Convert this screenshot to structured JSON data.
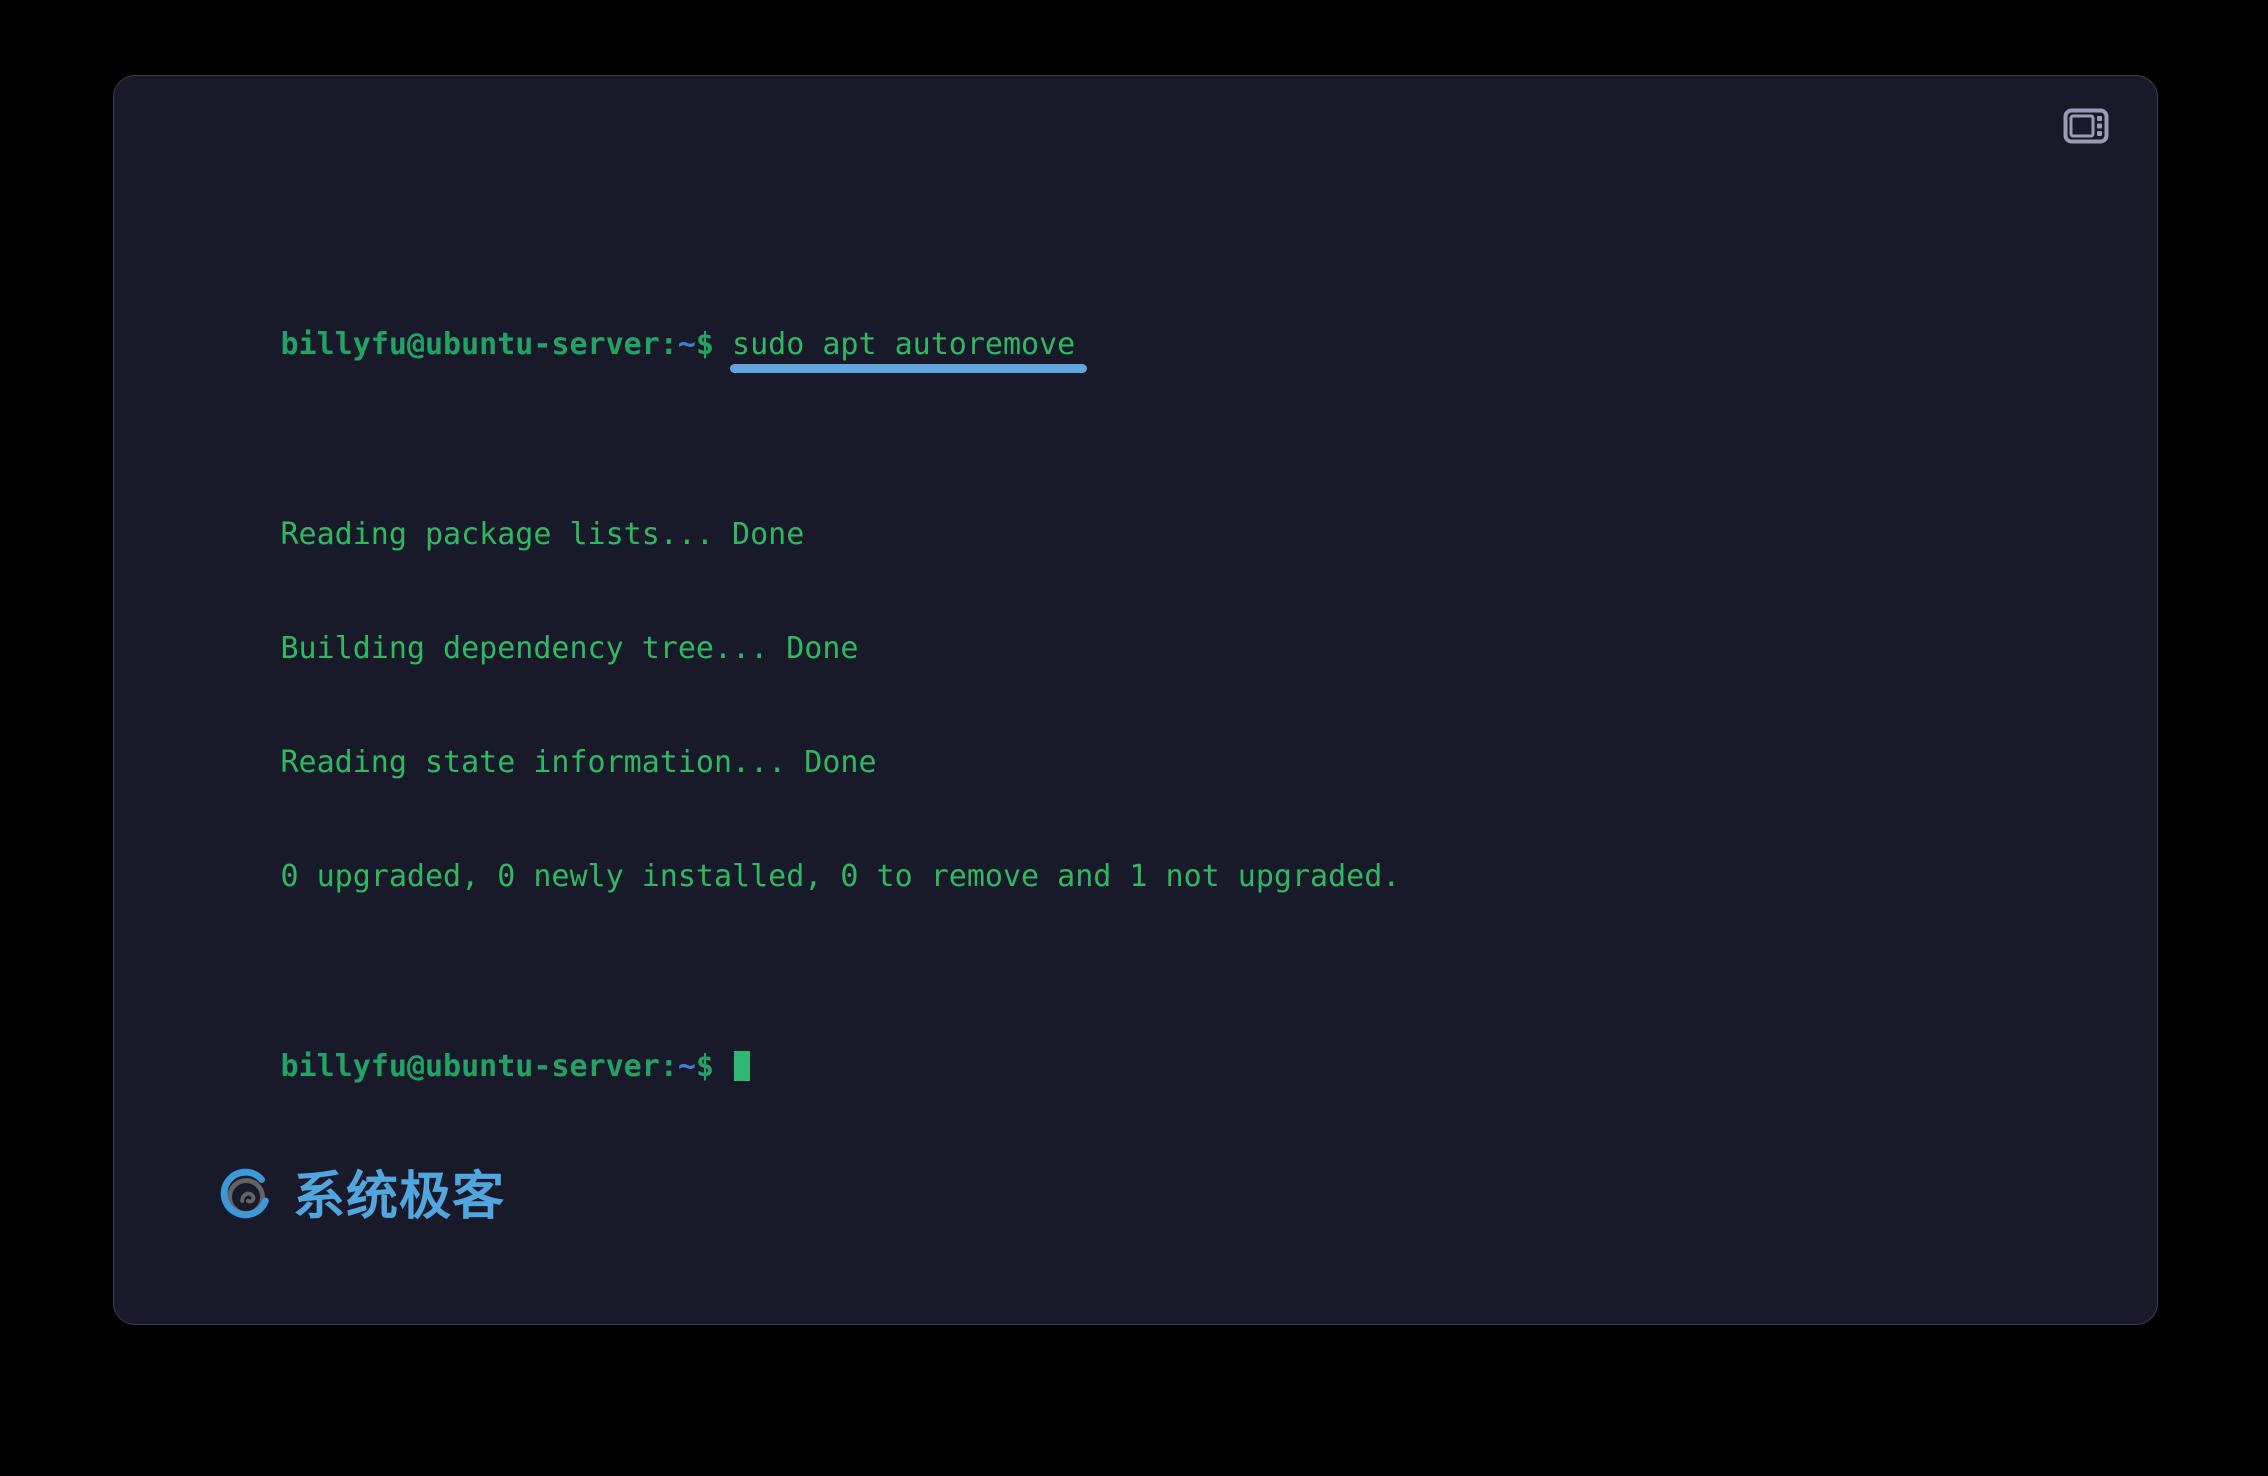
{
  "window": {
    "background_color": "#181a2a",
    "border_color": "#3a3d52",
    "page_background": "#000000"
  },
  "titlebar": {
    "layout_toggle_icon": "panel-layout-icon"
  },
  "terminal": {
    "prompt": {
      "user_host": "billyfu@ubuntu-server",
      "colon": ":",
      "tilde": "~",
      "dollar": "$"
    },
    "colors": {
      "prompt_green": "#21a366",
      "prompt_blue": "#3d7fd1",
      "output_green": "#2fb862",
      "underline_blue": "#63a6dd",
      "cursor_green": "#2eb872"
    },
    "lines": [
      {
        "type": "prompt-command",
        "command": "sudo apt autoremove",
        "underlined": true
      },
      {
        "type": "output",
        "text": "Reading package lists... Done"
      },
      {
        "type": "output",
        "text": "Building dependency tree... Done"
      },
      {
        "type": "output",
        "text": "Reading state information... Done"
      },
      {
        "type": "output",
        "text": "0 upgraded, 0 newly installed, 0 to remove and 1 not upgraded."
      },
      {
        "type": "prompt-cursor",
        "command": ""
      }
    ]
  },
  "watermark": {
    "text": "系统极客",
    "logo_icon": "spiral-circle-logo-icon",
    "color": "#57b2ef"
  }
}
